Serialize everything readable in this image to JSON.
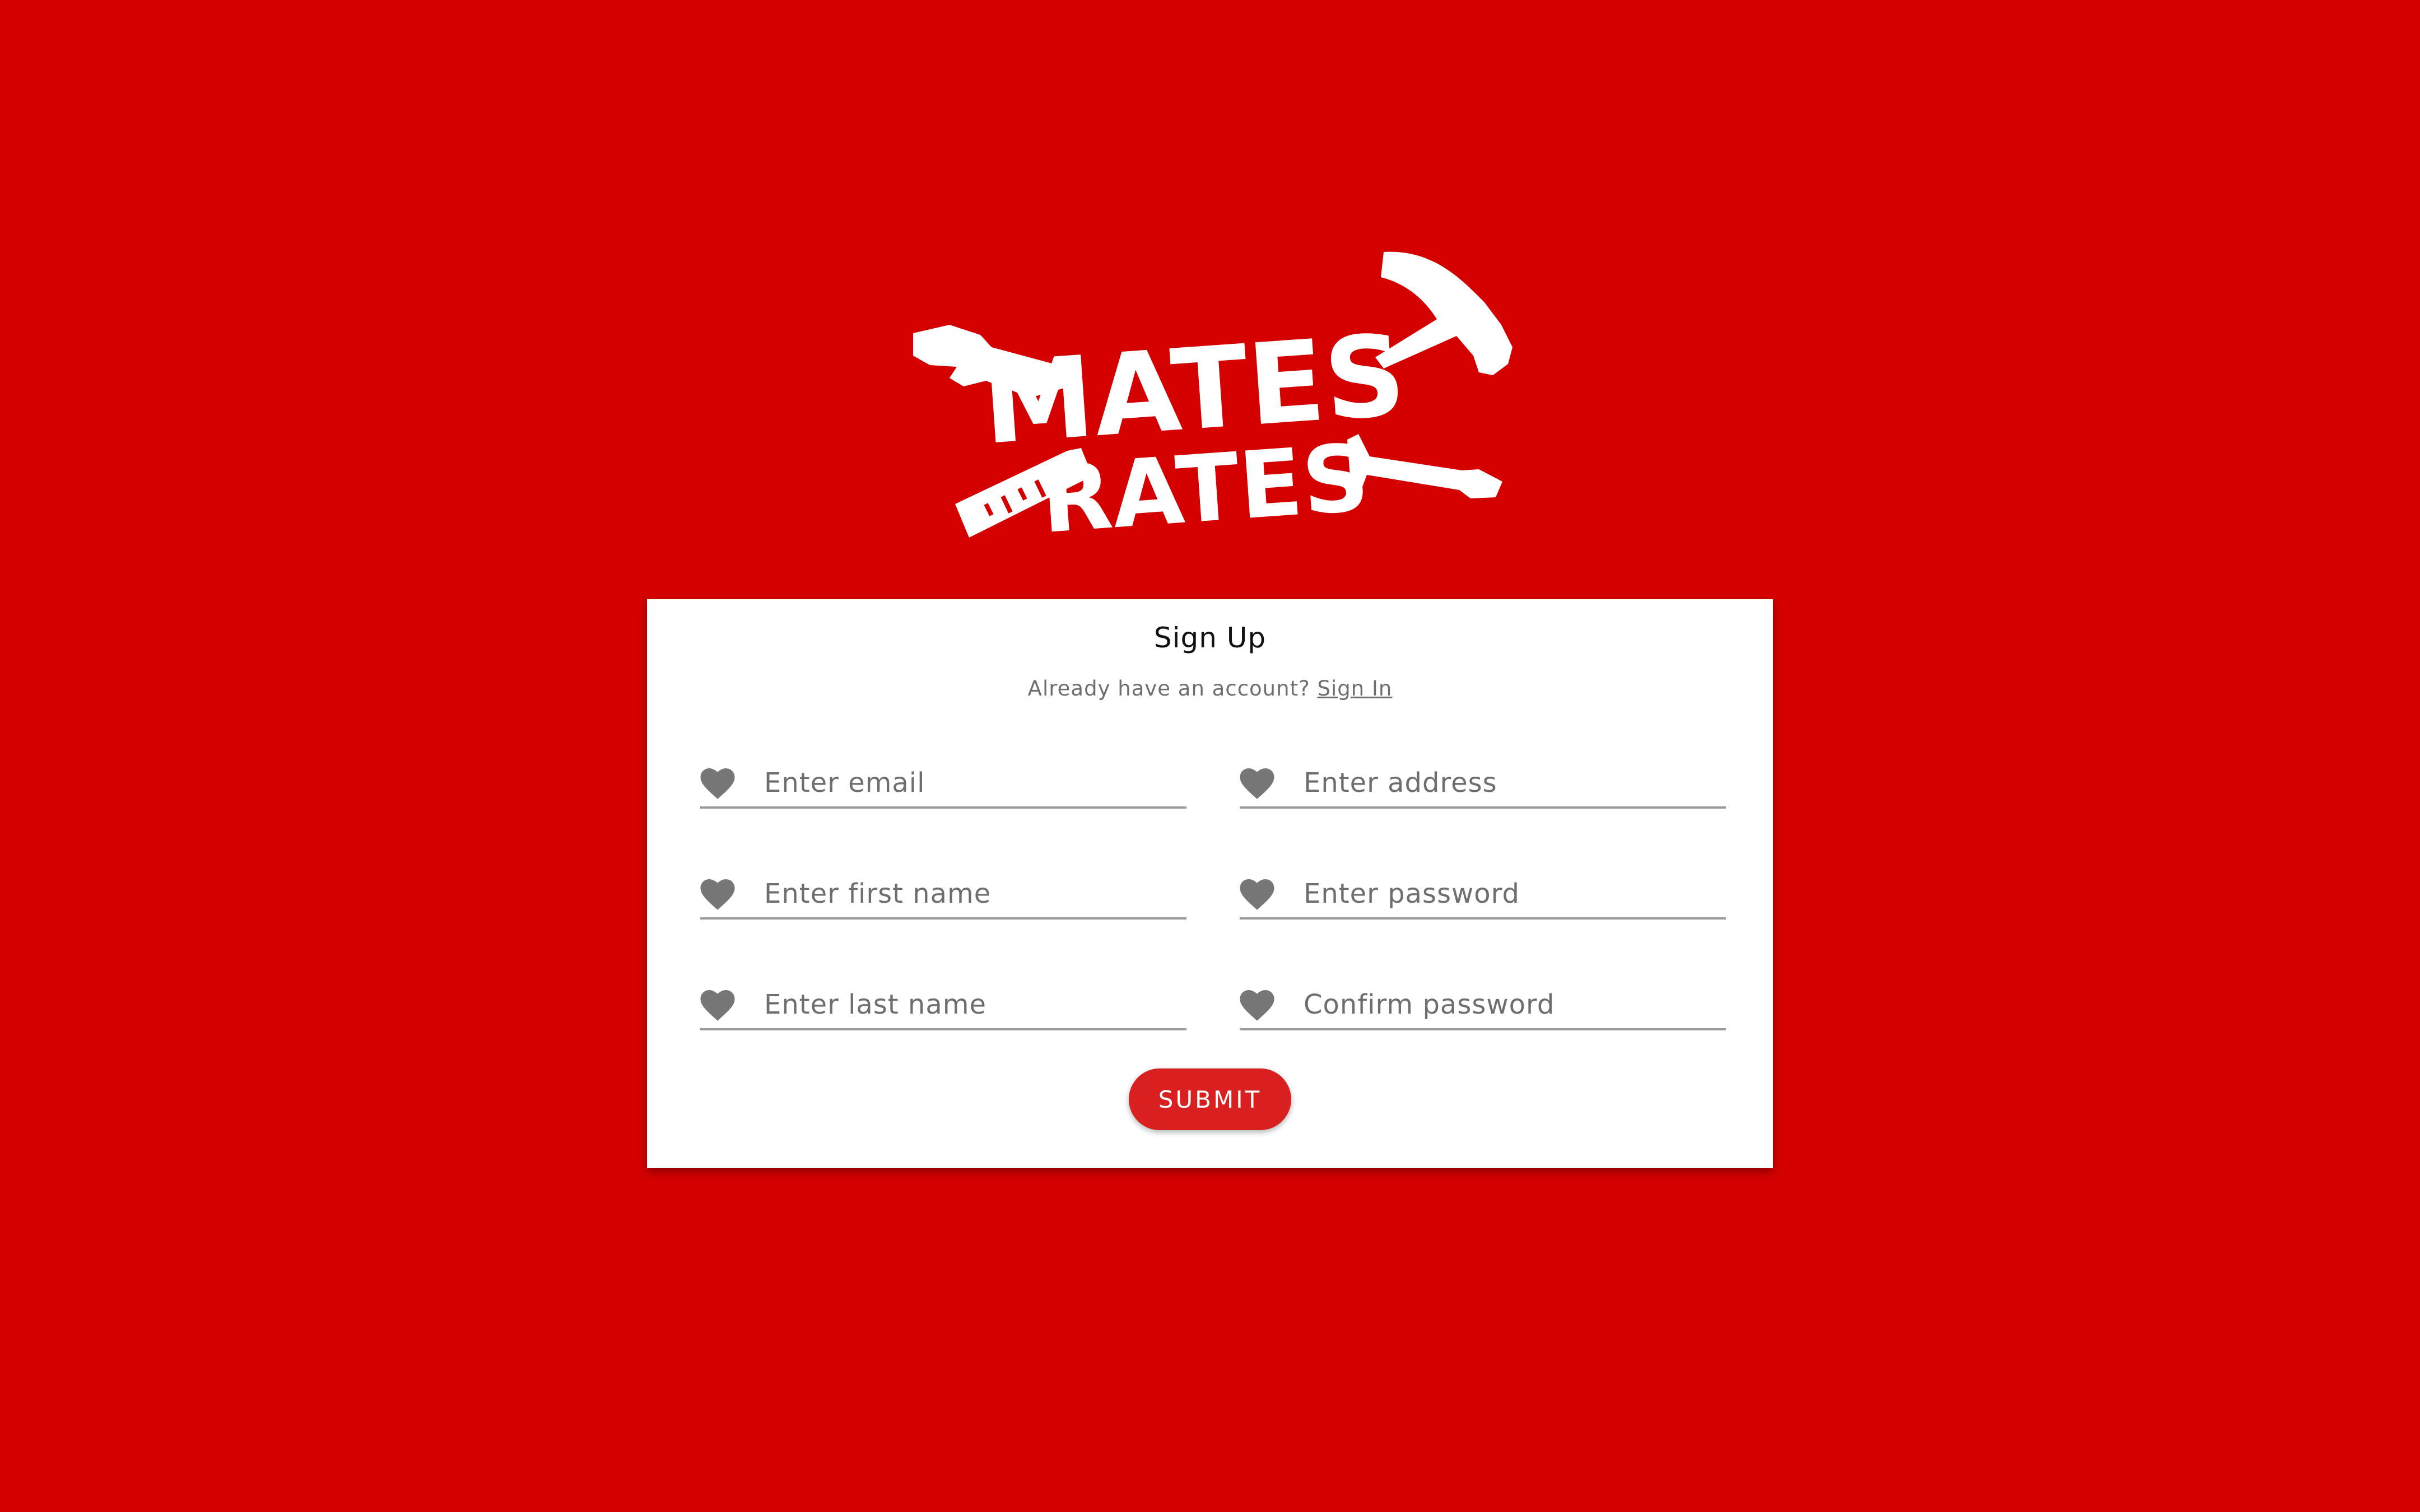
{
  "brand": {
    "logo_text_line1": "MATES",
    "logo_text_line2": "RATES",
    "background_color": "#d40000",
    "accent_color": "#d82020"
  },
  "signup": {
    "title": "Sign Up",
    "account_prompt": "Already have an account?",
    "signin_link": "Sign In",
    "submit_label": "SUBMIT",
    "fields": {
      "email": {
        "placeholder": "Enter email",
        "value": "",
        "icon": "heart-icon"
      },
      "address": {
        "placeholder": "Enter address",
        "value": "",
        "icon": "heart-icon"
      },
      "first_name": {
        "placeholder": "Enter first name",
        "value": "",
        "icon": "heart-icon"
      },
      "password": {
        "placeholder": "Enter password",
        "value": "",
        "icon": "heart-icon"
      },
      "last_name": {
        "placeholder": "Enter last name",
        "value": "",
        "icon": "heart-icon"
      },
      "confirm_password": {
        "placeholder": "Confirm password",
        "value": "",
        "icon": "heart-icon"
      }
    }
  }
}
